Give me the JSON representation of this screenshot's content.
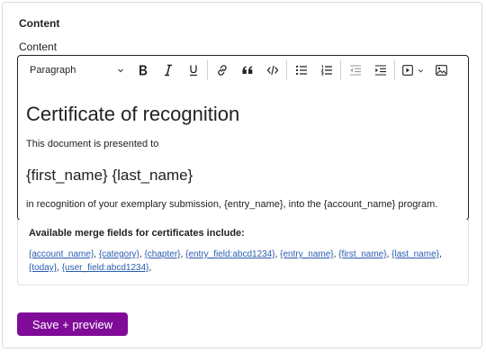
{
  "section": {
    "title": "Content"
  },
  "field": {
    "label": "Content"
  },
  "toolbar": {
    "block_format": "Paragraph",
    "buttons": [
      {
        "name": "bold",
        "icon": "bold-icon"
      },
      {
        "name": "italic",
        "icon": "italic-icon"
      },
      {
        "name": "underline",
        "icon": "underline-icon"
      },
      {
        "name": "link",
        "icon": "link-icon"
      },
      {
        "name": "blockquote",
        "icon": "quote-icon"
      },
      {
        "name": "code",
        "icon": "code-icon"
      },
      {
        "name": "bulleted-list",
        "icon": "bulleted-list-icon"
      },
      {
        "name": "numbered-list",
        "icon": "numbered-list-icon"
      },
      {
        "name": "outdent",
        "icon": "outdent-icon",
        "disabled": true
      },
      {
        "name": "indent",
        "icon": "indent-icon"
      },
      {
        "name": "media",
        "icon": "media-embed-icon"
      },
      {
        "name": "image",
        "icon": "image-icon"
      }
    ]
  },
  "document": {
    "heading": "Certificate of recognition",
    "intro": "This document is presented to",
    "recipient": "{first_name} {last_name}",
    "body": "in recognition of your exemplary submission, {entry_name}, into the {account_name} program."
  },
  "merge": {
    "title": "Available merge fields for certificates include:",
    "fields": [
      "{account_name}",
      "{category}",
      "{chapter}",
      "{entry_field:abcd1234}",
      "{entry_name}",
      "{first_name}",
      "{last_name}",
      "{today}",
      "{user_field:abcd1234}"
    ]
  },
  "actions": {
    "save_label": "Save + preview"
  },
  "colors": {
    "primary": "#800b98",
    "link": "#2a5db0"
  }
}
